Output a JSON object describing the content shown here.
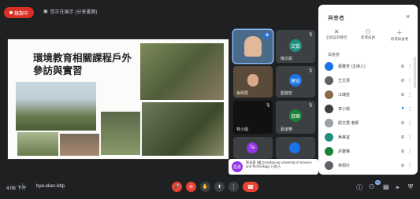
{
  "topbar": {
    "rec_label": "錄製中",
    "present_text": "您正在展示 (分享畫面)"
  },
  "slide": {
    "title_line1": "環境教育相關課程戶外",
    "title_line2": "參訪與實習"
  },
  "tiles": [
    {
      "name": "",
      "avatar": "",
      "color": "#4a6b8a"
    },
    {
      "name": "陳文凱",
      "avatar": "文凱",
      "color": "#1e8e7e"
    },
    {
      "name": "吳明慧",
      "avatar": "",
      "color": "#6a5a4a"
    },
    {
      "name": "劉建宏",
      "avatar": "建宏",
      "color": "#1a73e8"
    },
    {
      "name": "林小姐",
      "avatar": "",
      "color": "#111111"
    },
    {
      "name": "蔡淑華",
      "avatar": "淑華",
      "color": "#188038"
    },
    {
      "name": "",
      "avatar": "Ta",
      "color": "#9334e6"
    },
    {
      "name": "",
      "avatar": "",
      "color": "#1a73e8"
    }
  ],
  "toast": {
    "avatar": "芸嘉",
    "text": "蔡芸嘉 (國立Kaohsiung University of Science and Technology) 已加入"
  },
  "panel": {
    "title": "與會者",
    "close": "×",
    "tools": [
      {
        "icon": "mic-off-icon",
        "glyph": "🎤",
        "label": "全部設為靜音"
      },
      {
        "icon": "people-icon",
        "glyph": "👥",
        "label": "新增成員"
      },
      {
        "icon": "add-person-icon",
        "glyph": "➕",
        "label": "新增與會者"
      }
    ],
    "section_label": "與會者",
    "people": [
      {
        "name": "蔡雅芳 (主持人)",
        "color": "#1a73e8"
      },
      {
        "name": "王文慧",
        "color": "#5f6368"
      },
      {
        "name": "江瑞芸",
        "color": "#8a6a4a"
      },
      {
        "name": "李小瑜",
        "color": "#3c4043"
      },
      {
        "name": "廖文君 老師",
        "color": "#9aa0a6"
      },
      {
        "name": "吳美宜",
        "color": "#1e8e7e"
      },
      {
        "name": "許雅琳",
        "color": "#188038"
      },
      {
        "name": "林佩玲",
        "color": "#5f6368"
      },
      {
        "name": "吳瑜",
        "color": "#1a73e8"
      }
    ]
  },
  "bottom": {
    "time": "4:06 下午",
    "code": "bya-okec-kbp",
    "badge_count": "31"
  }
}
